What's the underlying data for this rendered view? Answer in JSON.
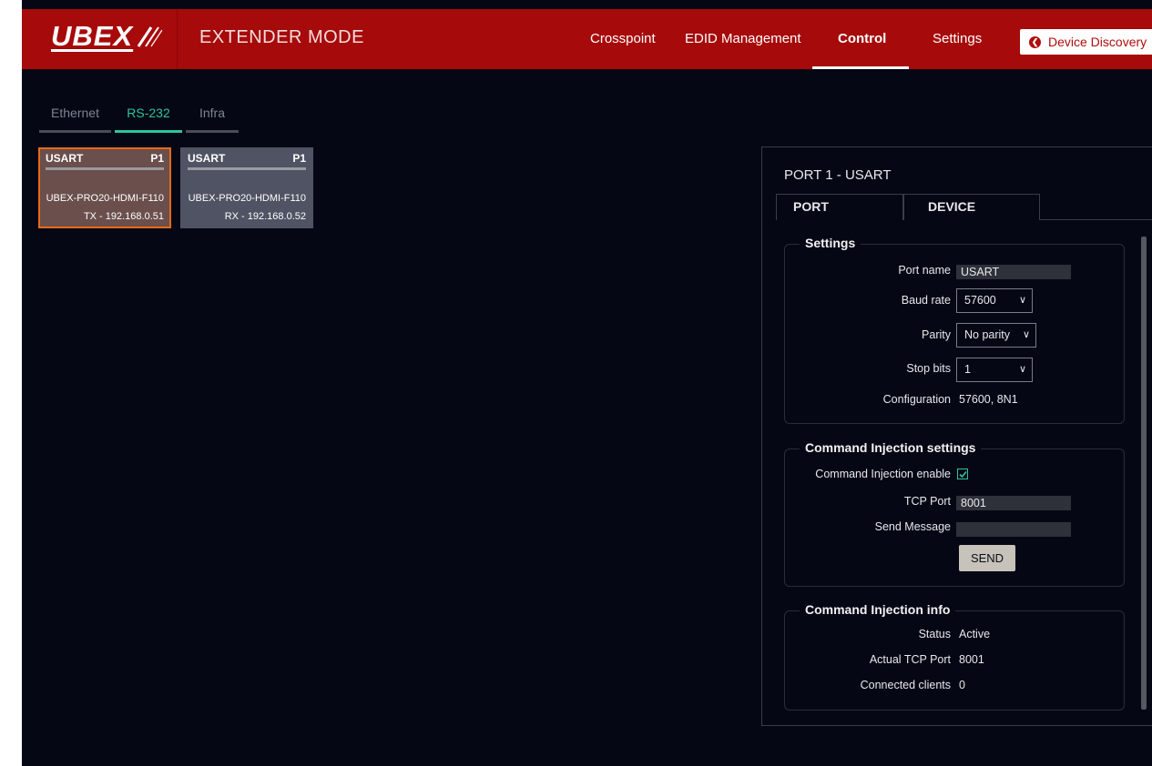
{
  "header": {
    "logo": "UBEX",
    "mode_title": "EXTENDER MODE",
    "nav": [
      "Crosspoint",
      "EDID Management",
      "Control",
      "Settings"
    ],
    "active_nav": "Control",
    "device_discovery": "Device Discovery"
  },
  "port_tabs": [
    "Ethernet",
    "RS-232",
    "Infra"
  ],
  "active_port_tab": "RS-232",
  "cards": [
    {
      "name": "USART",
      "port": "P1",
      "device": "UBEX-PRO20-HDMI-F110",
      "address": "TX - 192.168.0.51",
      "selected": true
    },
    {
      "name": "USART",
      "port": "P1",
      "device": "UBEX-PRO20-HDMI-F110",
      "address": "RX - 192.168.0.52",
      "selected": false
    }
  ],
  "panel": {
    "title": "PORT 1 - USART",
    "tabs": [
      "PORT",
      "DEVICE"
    ],
    "active_tab": "PORT",
    "settings": {
      "legend": "Settings",
      "port_name_label": "Port name",
      "port_name_value": "USART",
      "baud_rate_label": "Baud rate",
      "baud_rate_value": "57600",
      "parity_label": "Parity",
      "parity_value": "No parity",
      "stop_bits_label": "Stop bits",
      "stop_bits_value": "1",
      "configuration_label": "Configuration",
      "configuration_value": "57600, 8N1"
    },
    "injection_settings": {
      "legend": "Command Injection settings",
      "enable_label": "Command Injection enable",
      "enabled": true,
      "tcp_port_label": "TCP Port",
      "tcp_port_value": "8001",
      "send_message_label": "Send Message",
      "send_message_value": "",
      "send_button": "SEND"
    },
    "injection_info": {
      "legend": "Command Injection info",
      "status_label": "Status",
      "status_value": "Active",
      "actual_tcp_port_label": "Actual TCP Port",
      "actual_tcp_port_value": "8001",
      "connected_clients_label": "Connected clients",
      "connected_clients_value": "0"
    }
  },
  "colors": {
    "brand_red": "#a60a0a",
    "accent_green": "#2ec49c",
    "selected_card_border": "#e66a18",
    "background": "#050814"
  }
}
